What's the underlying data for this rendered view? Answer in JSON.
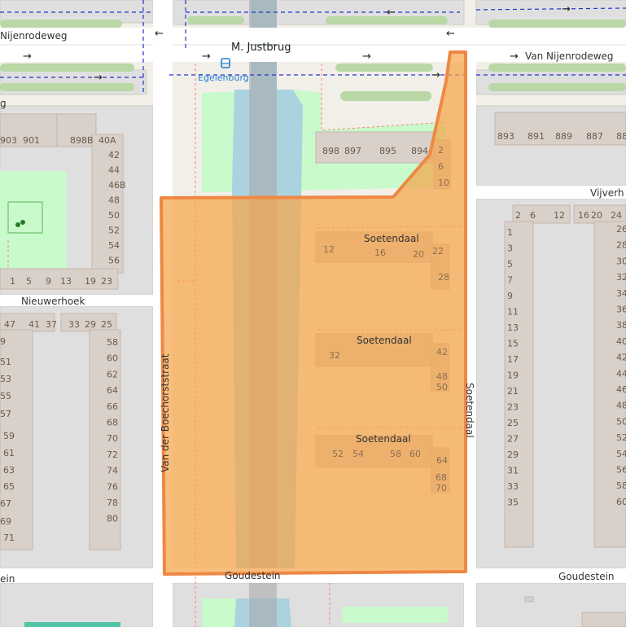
{
  "map": {
    "streets": {
      "nijenrodeweg_left": "Nijenrodeweg",
      "justbrug": "M. Justbrug",
      "van_nijenrodeweg": "Van Nijenrodeweg",
      "nieuwerhoek": "Nieuwerhoek",
      "van_der_boechorststraat": "Van der Boechorststraat",
      "soetendaal_vertical": "Soetendaal",
      "soetendaal_1": "Soetendaal",
      "soetendaal_2": "Soetendaal",
      "soetendaal_3": "Soetendaal",
      "goudestein_center": "Goudestein",
      "goudestein_right": "Goudestein",
      "goudestein_left_fragment": "ein",
      "vijverhof_fragment": "Vijverh",
      "left_edge_fragment": "g"
    },
    "bus_stop": {
      "name": "Egelenburg",
      "icon": "bus-stop-icon",
      "color": "#1a7fd4"
    },
    "colors": {
      "highlight_fill": "#f5a54a",
      "highlight_stroke": "#ee8844",
      "water": "#aad3df",
      "park": "#c8facc",
      "building": "#d9d0c9",
      "background": "#f2efe9"
    },
    "house_numbers": {
      "topleft_row": [
        "903",
        "901",
        "898B",
        "40A"
      ],
      "topleft_col": [
        "42",
        "44",
        "46B",
        "48",
        "50",
        "52",
        "54",
        "56"
      ],
      "topleft_bottom": [
        "1",
        "5",
        "9",
        "13",
        "19",
        "23"
      ],
      "top_center": [
        "898",
        "897",
        "895",
        "894"
      ],
      "top_center_small": [
        "2",
        "6",
        "10"
      ],
      "top_right": [
        "893",
        "891",
        "889",
        "887",
        "88"
      ],
      "nieuwerhoek_row": [
        "47",
        "41",
        "37",
        "33",
        "29",
        "25"
      ],
      "left_block_a": [
        "9",
        "51",
        "53",
        "55",
        "57",
        "59",
        "61",
        "63",
        "65",
        "67",
        "69",
        "71"
      ],
      "left_block_b": [
        "58",
        "60",
        "62",
        "64",
        "66",
        "68",
        "70",
        "72",
        "74",
        "76",
        "78",
        "80"
      ],
      "soetendaal_1_nums": [
        "12",
        "16",
        "20",
        "22",
        "28"
      ],
      "soetendaal_2_nums": [
        "32",
        "42",
        "48",
        "50"
      ],
      "soetendaal_3_nums": [
        "52",
        "54",
        "58",
        "60",
        "64",
        "68",
        "70"
      ],
      "right_top_row": [
        "2",
        "6",
        "12",
        "16",
        "20",
        "24"
      ],
      "right_col_a": [
        "1",
        "3",
        "5",
        "7",
        "9",
        "11",
        "13",
        "15",
        "17",
        "19",
        "21",
        "23",
        "25",
        "27",
        "29",
        "31",
        "33",
        "35"
      ],
      "right_col_b": [
        "26",
        "28",
        "30",
        "32",
        "34",
        "36",
        "38",
        "40",
        "42",
        "44",
        "46",
        "48",
        "50",
        "52",
        "54",
        "56",
        "58",
        "60"
      ]
    }
  }
}
